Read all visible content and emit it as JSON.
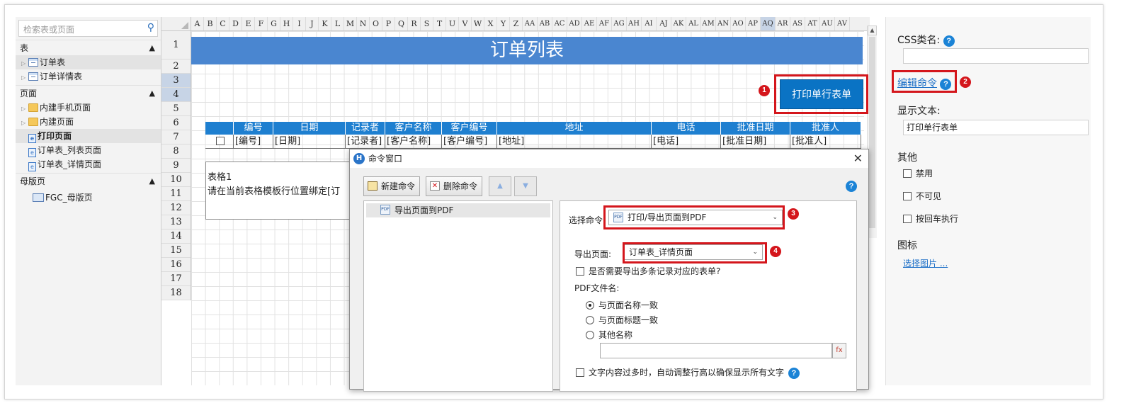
{
  "left_panel": {
    "search_placeholder": "检索表或页面",
    "sections": {
      "tables": {
        "title": "表",
        "items": [
          "订单表",
          "订单详情表"
        ]
      },
      "pages": {
        "title": "页面",
        "items": [
          "内建手机页面",
          "内建页面",
          "打印页面",
          "订单表_列表页面",
          "订单表_详情页面"
        ]
      },
      "masters": {
        "title": "母版页",
        "items": [
          "FGC_母版页"
        ]
      }
    }
  },
  "grid": {
    "columns": [
      "A",
      "B",
      "C",
      "D",
      "E",
      "F",
      "G",
      "H",
      "I",
      "J",
      "K",
      "L",
      "M",
      "N",
      "O",
      "P",
      "Q",
      "R",
      "S",
      "T",
      "U",
      "V",
      "W",
      "X",
      "Y",
      "Z",
      "AA",
      "AB",
      "AC",
      "AD",
      "AE",
      "AF",
      "AG",
      "AH",
      "AI",
      "AJ",
      "AK",
      "AL",
      "AM",
      "AN",
      "AO",
      "AP",
      "AQ",
      "AR",
      "AS",
      "AT",
      "AU",
      "AV"
    ],
    "rows": [
      "1",
      "2",
      "3",
      "4",
      "5",
      "6",
      "7",
      "8",
      "9",
      "10",
      "11",
      "12",
      "13",
      "14",
      "15",
      "16",
      "17",
      "18"
    ],
    "banner_title": "订单列表",
    "print_button_label": "打印单行表单",
    "table_headers": [
      "编号",
      "日期",
      "记录者",
      "客户名称",
      "客户编号",
      "地址",
      "电话",
      "批准日期",
      "批准人"
    ],
    "table_row": [
      "[编号]",
      "[日期]",
      "[记录者]",
      "[客户名称]",
      "[客户编号]",
      "[地址]",
      "[电话]",
      "[批准日期]",
      "[批准人]"
    ],
    "table_box_line1": "表格1",
    "table_box_line2": "请在当前表格模板行位置绑定[订"
  },
  "dialog": {
    "title": "命令窗口",
    "new_command": "新建命令",
    "delete_command": "删除命令",
    "command_list": [
      "导出页面到PDF"
    ],
    "select_command_label": "选择命令:",
    "select_command_value": "打印/导出页面到PDF",
    "export_page_label": "导出页面:",
    "export_page_value": "订单表_详情页面",
    "multi_record_label": "是否需要导出多条记录对应的表单?",
    "pdf_filename_label": "PDF文件名:",
    "radio_options": [
      "与页面名称一致",
      "与页面标题一致",
      "其他名称"
    ],
    "radio_selected": 0,
    "auto_row_height_label": "文字内容过多时，自动调整行高以确保显示所有文字"
  },
  "right_panel": {
    "css_label": "CSS类名:",
    "edit_command_link": "编辑命令",
    "display_text_label": "显示文本:",
    "display_text_value": "打印单行表单",
    "other_label": "其他",
    "options": [
      "禁用",
      "不可见",
      "按回车执行"
    ],
    "icon_label": "图标",
    "select_image_link": "选择图片 ..."
  },
  "badges": [
    "1",
    "2",
    "3",
    "4"
  ],
  "colors": {
    "accent_blue": "#1e7fd0",
    "banner_blue": "#4a86d0",
    "highlight_red": "#d4161c"
  }
}
